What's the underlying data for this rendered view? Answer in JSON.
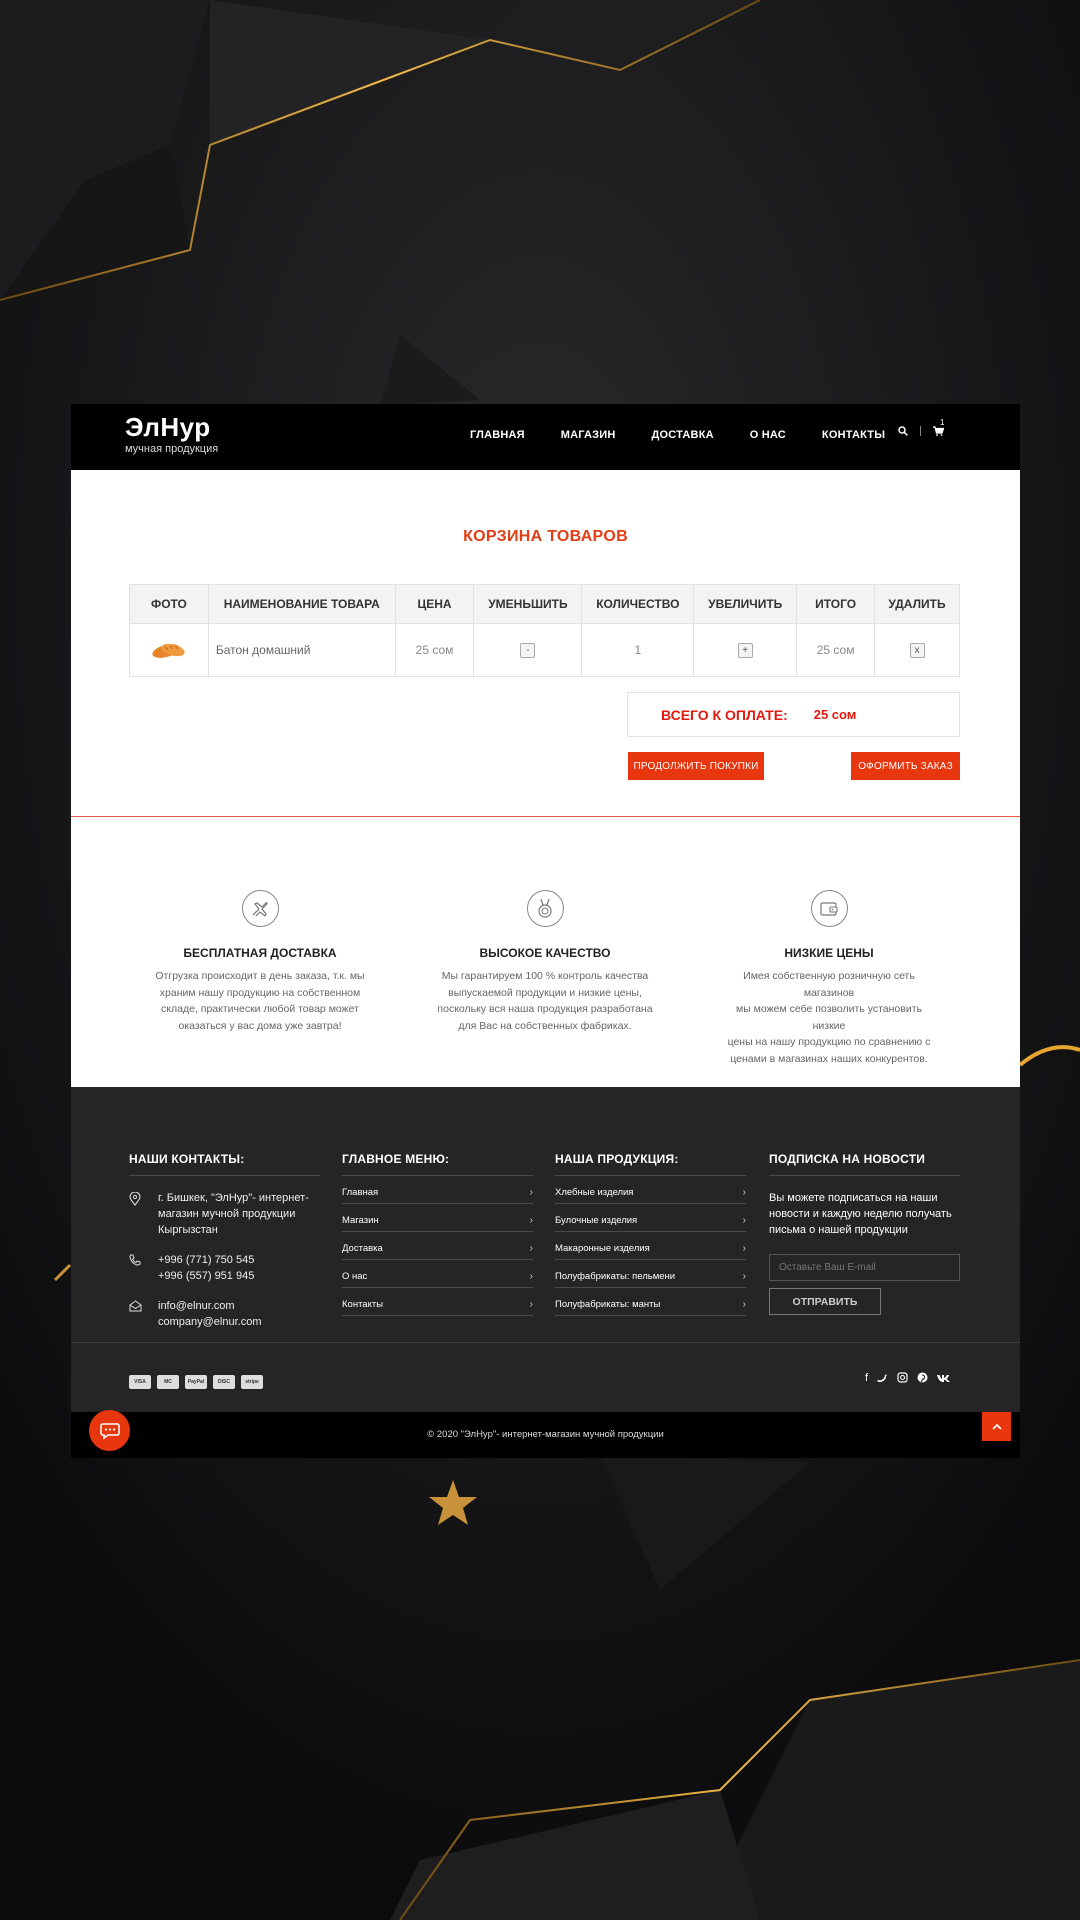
{
  "header": {
    "logo_title": "ЭлНур",
    "logo_subtitle": "мучная продукция",
    "nav": [
      "ГЛАВНАЯ",
      "МАГАЗИН",
      "ДОСТАВКА",
      "О НАС",
      "КОНТАКТЫ"
    ],
    "cart_count": "1"
  },
  "cart": {
    "title": "КОРЗИНА ТОВАРОВ",
    "columns": [
      "ФОТО",
      "НАИМЕНОВАНИЕ ТОВАРА",
      "ЦЕНА",
      "УМЕНЬШИТЬ",
      "КОЛИЧЕСТВО",
      "УВЕЛИЧИТЬ",
      "ИТОГО",
      "УДАЛИТЬ"
    ],
    "rows": [
      {
        "name": "Батон домашний",
        "price": "25 сом",
        "decrease": "-",
        "quantity": "1",
        "increase": "+",
        "total": "25 сом",
        "remove": "x"
      }
    ],
    "total_label": "ВСЕГО К ОПЛАТЕ:",
    "total_value": "25 сом",
    "continue_button": "ПРОДОЛЖИТЬ ПОКУПКИ",
    "checkout_button": "ОФОРМИТЬ ЗАКАЗ"
  },
  "features": [
    {
      "icon": "plane-icon",
      "title": "БЕСПЛАТНАЯ ДОСТАВКА",
      "lines": [
        "Отгрузка происходит в день заказа, т.к. мы",
        "храним нашу продукцию на собственном",
        "складе, практически любой товар может",
        "оказаться у вас дома уже завтра!"
      ]
    },
    {
      "icon": "medal-icon",
      "title": "ВЫСОКОЕ КАЧЕСТВО",
      "lines": [
        "Мы гарантируем 100 % контроль качества",
        "выпускаемой продукции и низкие цены,",
        "поскольку вся наша продукция разработана",
        "для Вас на собственных фабриках."
      ]
    },
    {
      "icon": "wallet-icon",
      "title": "НИЗКИЕ ЦЕНЫ",
      "lines": [
        "Имея собственную розничную сеть магазинов",
        "мы можем себе позволить установить низкие",
        "цены на нашу продукцию по сравнению с",
        "ценами в магазинах наших конкурентов."
      ]
    }
  ],
  "footer": {
    "contacts_title": "НАШИ КОНТАКТЫ:",
    "address": [
      "г. Бишкек, \"ЭлНур\"- интернет-",
      "магазин мучной продукции",
      "Кыргызстан"
    ],
    "phones": [
      "+996 (771) 750 545",
      "+996 (557) 951 945"
    ],
    "emails": [
      "info@elnur.com",
      "company@elnur.com"
    ],
    "menu_title": "ГЛАВНОЕ МЕНЮ:",
    "menu": [
      "Главная",
      "Магазин",
      "Доставка",
      "О нас",
      "Контакты"
    ],
    "products_title": "НАША ПРОДУКЦИЯ:",
    "products": [
      "Хлебные изделия",
      "Булочные изделия",
      "Макаронные изделия",
      "Полуфабрикаты: пельмени",
      "Полуфабрикаты: манты"
    ],
    "subscribe_title": "ПОДПИСКА НА НОВОСТИ",
    "subscribe_lines": [
      "Вы можете подписаться на наши",
      "новости и каждую неделю получать",
      "письма о нашей продукции"
    ],
    "email_placeholder": "Оставьте Ваш E-mail",
    "send_button": "ОТПРАВИТЬ",
    "payments": [
      "VISA",
      "MC",
      "PayPal",
      "DISC",
      "stripe"
    ],
    "social": [
      "facebook-icon",
      "twitter-icon",
      "instagram-icon",
      "pinterest-icon",
      "vk-icon"
    ],
    "copyright": "© 2020 \"ЭлНур\"- интернет-магазин мучной продукции"
  },
  "colors": {
    "accent": "#e8370f",
    "total_red": "#e2190f",
    "footer_bg": "#252525",
    "header_bg": "#000000"
  }
}
